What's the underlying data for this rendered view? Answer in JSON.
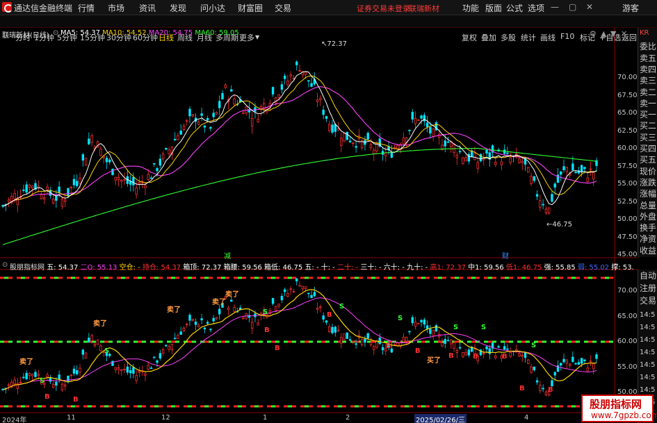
{
  "titlebar": {
    "app": "通达信金融终端",
    "menus": [
      "行情",
      "市场",
      "资讯",
      "发现",
      "问小达",
      "财富圈",
      "交易"
    ],
    "alert": "证券交易未登录",
    "stock": "联瑞新材",
    "right": [
      "功能",
      "版面",
      "公式",
      "选项"
    ],
    "guest": "游客"
  },
  "toolbar": {
    "periods": [
      "分时",
      "1分钟",
      "5分钟",
      "15分钟",
      "30分钟",
      "60分钟",
      "日线",
      "周线",
      "月线",
      "多周期",
      "更多"
    ],
    "active": "日线",
    "right": [
      "复权",
      "叠加",
      "多股",
      "统计",
      "画线",
      "F10",
      "标记",
      "+自选",
      "返回"
    ]
  },
  "main": {
    "stock_label": "联瑞新材(日线)",
    "ma": [
      {
        "label": "MA5: 54.37",
        "color": "#ffffff"
      },
      {
        "label": "MA10: 54.52",
        "color": "#ffd400"
      },
      {
        "label": "MA20: 54.75",
        "color": "#ff40ff"
      },
      {
        "label": "MA60: 59.05",
        "color": "#30ff30"
      }
    ],
    "high_label": "72.37",
    "low_label": "46.75",
    "event1": "减",
    "event2": "财",
    "y_ticks": [
      "70.00",
      "67.50",
      "65.00",
      "62.50",
      "60.00",
      "57.50",
      "55.00",
      "52.50",
      "50.00",
      "47.50",
      "45.00"
    ]
  },
  "indicator": {
    "name": "股朋指标网",
    "items": [
      {
        "t": "五: 54.37",
        "c": "#ffffff"
      },
      {
        "t": "二O: 55.13",
        "c": "#ff40ff"
      },
      {
        "t": "空仓: -",
        "c": "#ffd400"
      },
      {
        "t": "持仓: 54.37",
        "c": "#ff3030"
      },
      {
        "t": "箱顶: 72.37",
        "c": "#ffffff"
      },
      {
        "t": "箱腰: 59.56",
        "c": "#ffffff"
      },
      {
        "t": "箱低: 46.75",
        "c": "#ffffff"
      },
      {
        "t": "五: -",
        "c": "#ffffff"
      },
      {
        "t": "十: -",
        "c": "#ffffff"
      },
      {
        "t": "二十: -",
        "c": "#ff4040"
      },
      {
        "t": "三十: -",
        "c": "#ffffff"
      },
      {
        "t": "六十: -",
        "c": "#ffffff"
      },
      {
        "t": "九十: -",
        "c": "#ffffff"
      },
      {
        "t": "高1: 72.37",
        "c": "#ff3030"
      },
      {
        "t": "中1: 59.56",
        "c": "#ffffff"
      },
      {
        "t": "低1: 46.75",
        "c": "#ff3030"
      },
      {
        "t": "强: 55.85",
        "c": "#ffffff"
      },
      {
        "t": "弱: 55.02",
        "c": "#3b6bff"
      },
      {
        "t": "撑: 53.",
        "c": "#ffffff"
      }
    ],
    "y_ticks": [
      "70.00",
      "65.00",
      "60.00",
      "55.00",
      "50.00"
    ],
    "sell_labels": [
      "卖了",
      "卖了",
      "卖了",
      "卖了",
      "卖了"
    ],
    "buy_label": "买了",
    "signals": {
      "b": "B",
      "s": "S"
    }
  },
  "sidepanel": {
    "top": [
      "KR",
      "委比",
      "卖五",
      "卖四",
      "卖三",
      "卖二",
      "卖一",
      "买一",
      "买二",
      "买三",
      "买四",
      "买五",
      "现价",
      "涨跌",
      "涨幅",
      "总量",
      "外盘",
      "换手",
      "净资",
      "收益"
    ],
    "bottom": [
      "自动",
      "注册",
      "交易"
    ],
    "times": [
      "14:5",
      "14:5",
      "14:5",
      "14:5",
      "14:5",
      "14:5",
      "14:5",
      "14:5"
    ]
  },
  "xaxis": {
    "labels": [
      "2024年",
      "11",
      "12",
      "1",
      "2",
      "2025/02/26/三",
      "4"
    ]
  },
  "watermark": {
    "line1": "股朋指标网",
    "line2": "www.7gpzb.com"
  }
}
